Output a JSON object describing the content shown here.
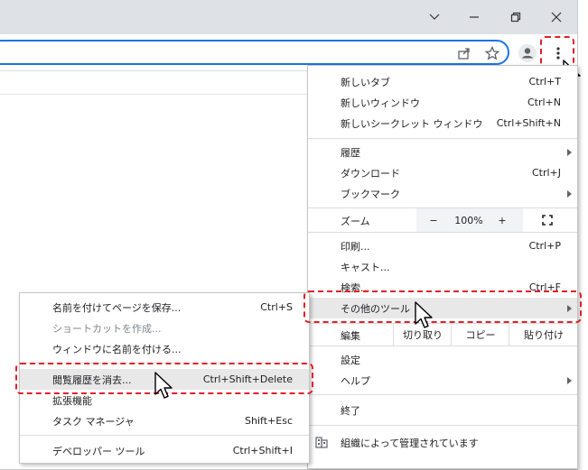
{
  "window": {
    "controls": [
      {
        "name": "tab-search-button",
        "icon": "chevron-down-icon"
      },
      {
        "name": "minimize-button",
        "icon": "minimize-icon"
      },
      {
        "name": "restore-button",
        "icon": "restore-icon"
      },
      {
        "name": "close-button",
        "icon": "close-icon"
      }
    ]
  },
  "toolbar": {
    "icons": [
      "share-icon",
      "bookmark-star-icon",
      "profile-avatar-icon",
      "kebab-menu-icon"
    ]
  },
  "main_menu": {
    "items": [
      {
        "label": "新しいタブ",
        "shortcut": "Ctrl+T"
      },
      {
        "label": "新しいウィンドウ",
        "shortcut": "Ctrl+N"
      },
      {
        "label": "新しいシークレット ウィンドウ",
        "shortcut": "Ctrl+Shift+N"
      },
      {
        "label": "履歴",
        "shortcut": ""
      },
      {
        "label": "ダウンロード",
        "shortcut": "Ctrl+J"
      },
      {
        "label": "ブックマーク",
        "shortcut": ""
      },
      {
        "label": "印刷...",
        "shortcut": "Ctrl+P"
      },
      {
        "label": "キャスト...",
        "shortcut": ""
      },
      {
        "label": "検索...",
        "shortcut": "Ctrl+F"
      },
      {
        "label": "その他のツール",
        "shortcut": ""
      },
      {
        "label": "設定",
        "shortcut": ""
      },
      {
        "label": "ヘルプ",
        "shortcut": ""
      },
      {
        "label": "終了",
        "shortcut": ""
      },
      {
        "label": "組織によって管理されています",
        "shortcut": ""
      }
    ],
    "zoom": {
      "label": "ズーム",
      "minus": "−",
      "value": "100%",
      "plus": "+"
    },
    "edit": {
      "label": "編集",
      "cut": "切り取り",
      "copy": "コピー",
      "paste": "貼り付け"
    }
  },
  "sub_menu": {
    "items": [
      {
        "label": "名前を付けてページを保存...",
        "shortcut": "Ctrl+S"
      },
      {
        "label": "ショートカットを作成...",
        "shortcut": ""
      },
      {
        "label": "ウィンドウに名前を付ける...",
        "shortcut": ""
      },
      {
        "label": "閲覧履歴を消去...",
        "shortcut": "Ctrl+Shift+Delete"
      },
      {
        "label": "拡張機能",
        "shortcut": ""
      },
      {
        "label": "タスク マネージャ",
        "shortcut": "Shift+Esc"
      },
      {
        "label": "デベロッパー ツール",
        "shortcut": "Ctrl+Shift+I"
      }
    ]
  },
  "colors": {
    "accent": "#1a73e8",
    "highlight_dash": "#e0202a",
    "titlebar": "#dee1e6"
  }
}
